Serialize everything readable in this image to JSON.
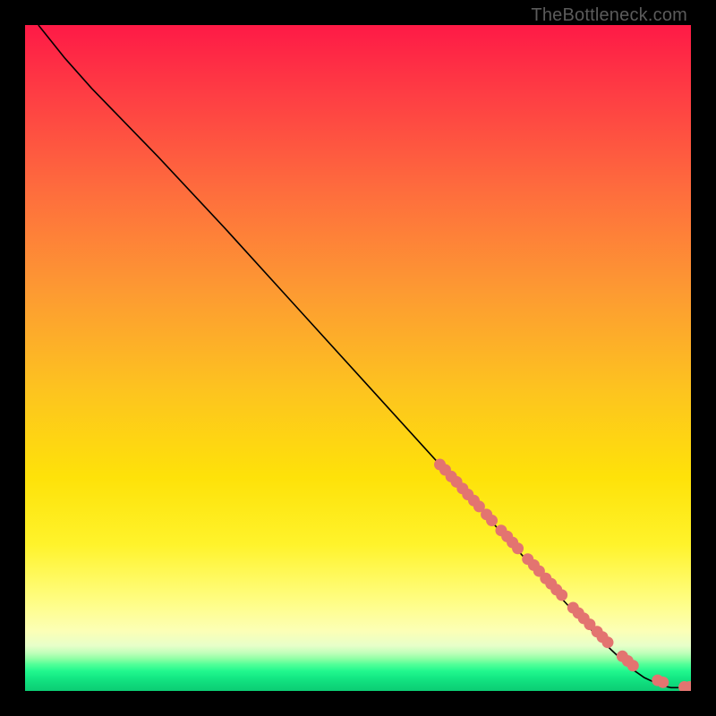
{
  "attribution": "TheBottleneck.com",
  "colors": {
    "gradient_top": "#fe1a46",
    "gradient_mid": "#fee209",
    "gradient_bottom": "#0ccd74",
    "dot": "#e37470",
    "curve": "#000000",
    "frame": "#000000"
  },
  "chart_data": {
    "type": "line",
    "title": "",
    "xlabel": "",
    "ylabel": "",
    "xlim": [
      0,
      100
    ],
    "ylim": [
      0,
      100
    ],
    "grid": false,
    "series": [
      {
        "name": "curve",
        "x": [
          2,
          6,
          10,
          20,
          30,
          40,
          50,
          60,
          65,
          70,
          75,
          80,
          84,
          88,
          91,
          93,
          94.5,
          95.5,
          96.3,
          97,
          98,
          99,
          100
        ],
        "y": [
          100,
          95,
          90.5,
          80.2,
          69.5,
          58.5,
          47.5,
          36.5,
          31,
          25.5,
          20,
          14.5,
          10.2,
          6.2,
          3.4,
          2.0,
          1.3,
          0.9,
          0.65,
          0.5,
          0.5,
          0.5,
          0.5
        ]
      }
    ],
    "dot_cluster": {
      "name": "highlighted-points",
      "x": [
        62.3,
        63.1,
        64.0,
        64.8,
        65.7,
        66.5,
        67.4,
        68.2,
        69.3,
        70.1,
        71.5,
        72.4,
        73.2,
        74.0,
        75.5,
        76.4,
        77.2,
        78.2,
        79.0,
        79.8,
        80.6,
        82.3,
        83.1,
        83.9,
        84.8,
        85.9,
        86.7,
        87.5,
        89.7,
        90.5,
        91.3,
        95.0,
        95.8,
        99.0,
        99.8
      ],
      "y": [
        34.0,
        33.2,
        32.2,
        31.4,
        30.4,
        29.5,
        28.6,
        27.7,
        26.5,
        25.6,
        24.1,
        23.2,
        22.3,
        21.4,
        19.8,
        18.9,
        18.0,
        16.9,
        16.1,
        15.2,
        14.4,
        12.5,
        11.7,
        10.9,
        10.0,
        8.9,
        8.1,
        7.3,
        5.2,
        4.5,
        3.8,
        1.6,
        1.3,
        0.6,
        0.6
      ]
    },
    "dot_radius_px": 6.5
  }
}
